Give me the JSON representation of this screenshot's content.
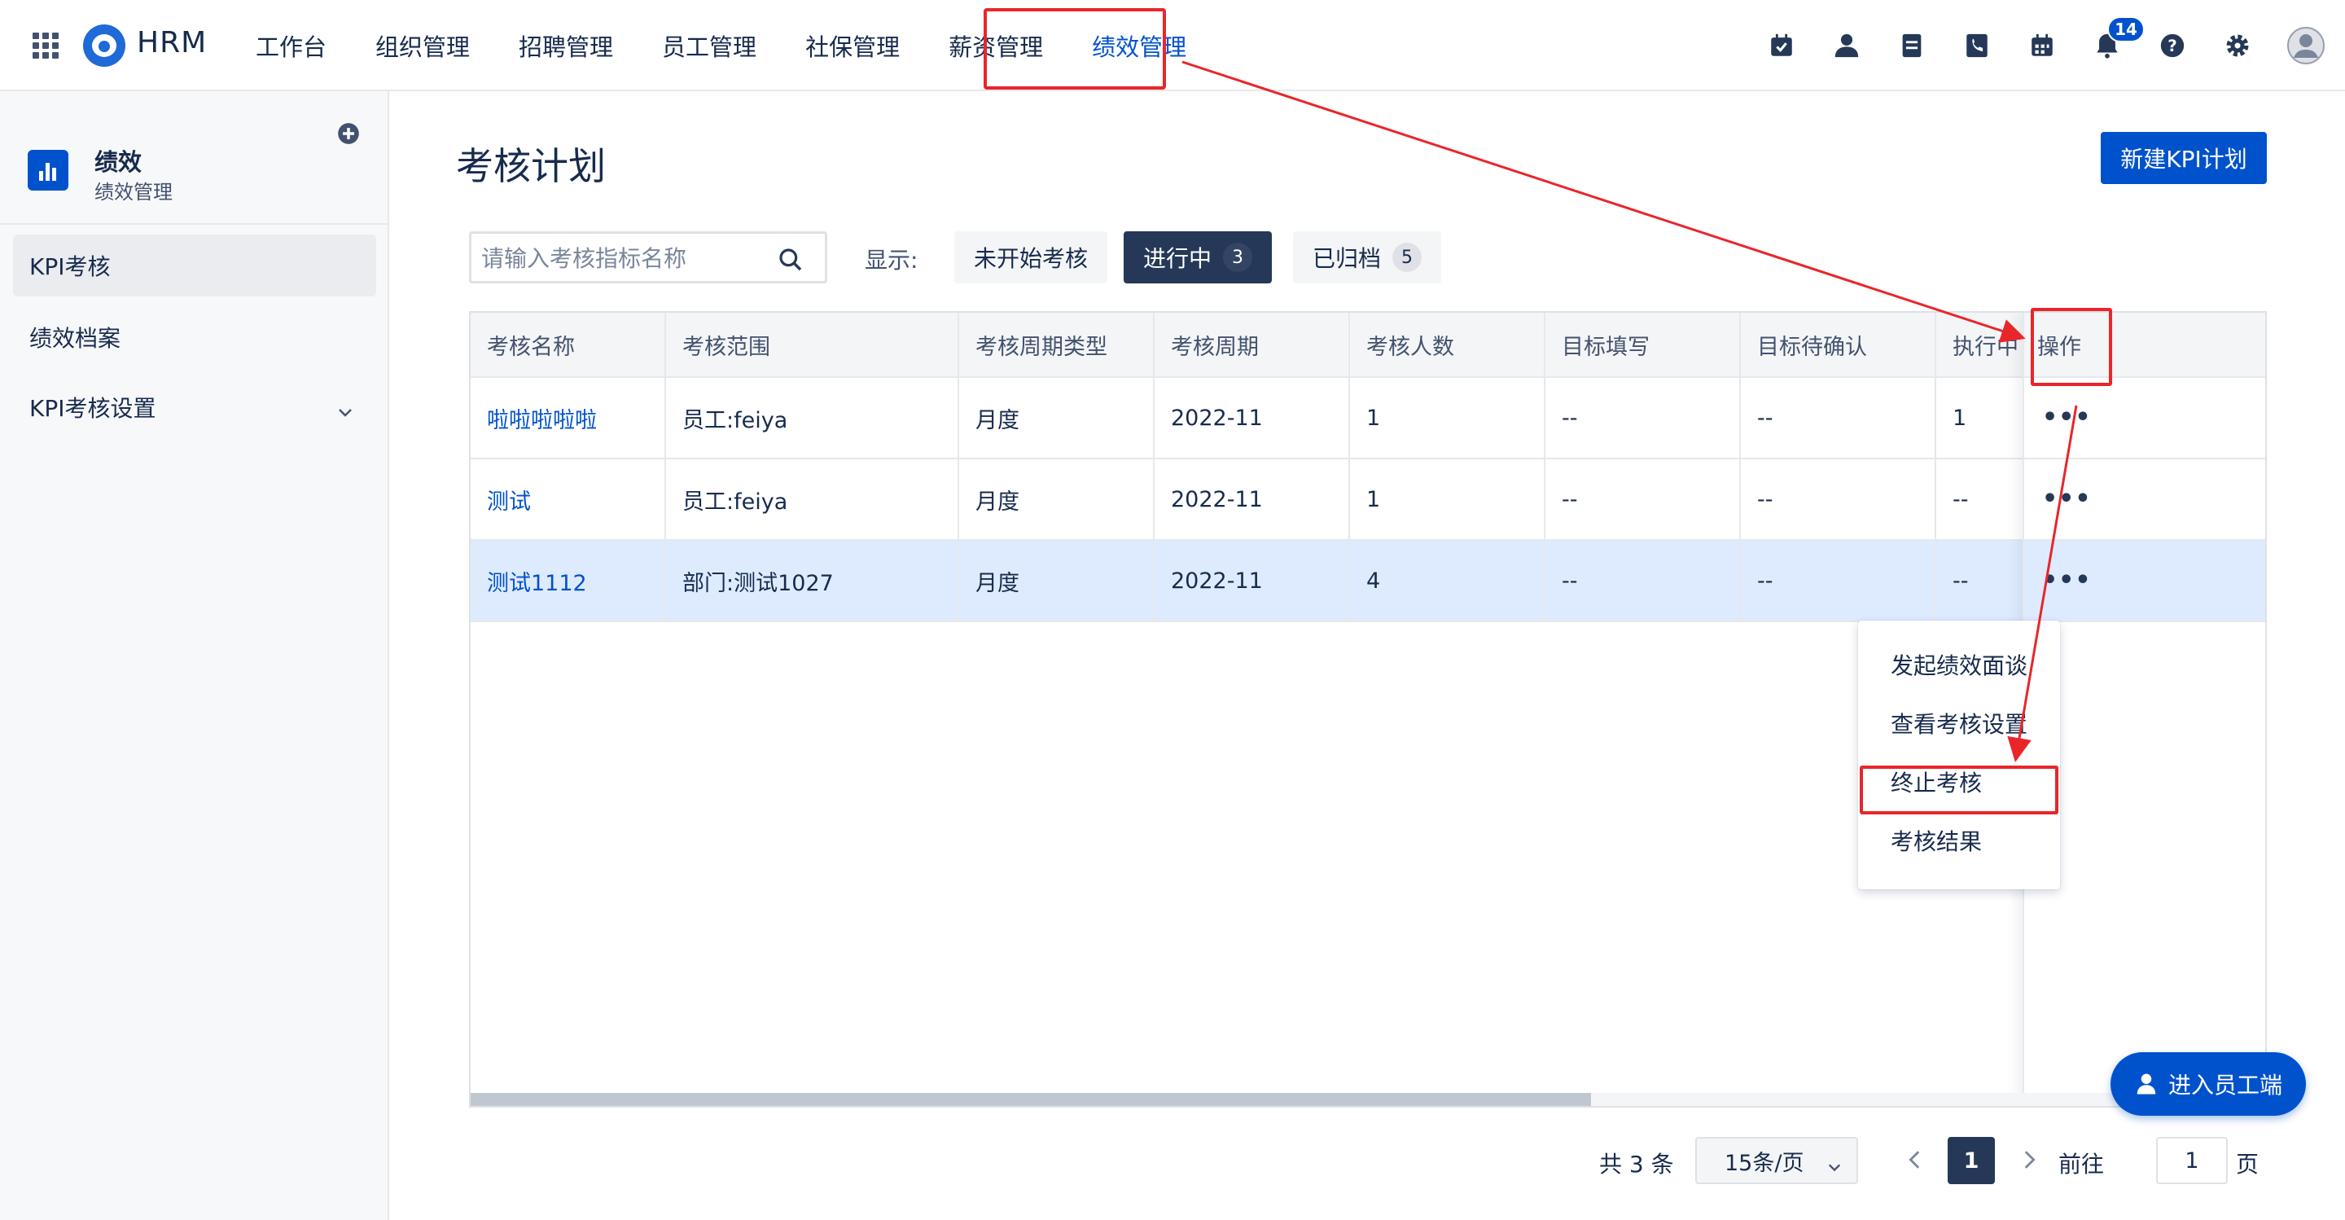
{
  "topbar": {
    "brand": "HRM",
    "nav": [
      "工作台",
      "组织管理",
      "招聘管理",
      "员工管理",
      "社保管理",
      "薪资管理",
      "绩效管理"
    ],
    "active_nav": "绩效管理",
    "notification_count": "14",
    "tool_icons": [
      "calendar-check-icon",
      "person-icon",
      "document-icon",
      "phone-icon",
      "calendar-icon",
      "bell-icon",
      "help-icon",
      "gear-icon",
      "avatar"
    ]
  },
  "sidebar": {
    "title": "绩效",
    "subtitle": "绩效管理",
    "items": [
      {
        "label": "KPI考核"
      },
      {
        "label": "绩效档案"
      },
      {
        "label": "KPI考核设置"
      }
    ]
  },
  "main": {
    "title": "考核计划",
    "new_button": "新建KPI计划",
    "search_placeholder": "请输入考核指标名称",
    "show_label": "显示:",
    "filters": [
      {
        "label": "未开始考核",
        "count": ""
      },
      {
        "label": "进行中",
        "count": "3"
      },
      {
        "label": "已归档",
        "count": "5"
      }
    ],
    "table": {
      "columns": [
        "考核名称",
        "考核范围",
        "考核周期类型",
        "考核周期",
        "考核人数",
        "目标填写",
        "目标待确认",
        "执行中"
      ],
      "op_column": "操作",
      "more_label": "•••",
      "rows": [
        [
          "啦啦啦啦啦",
          "员工:feiya",
          "月度",
          "2022-11",
          "1",
          "--",
          "--",
          "1"
        ],
        [
          "测试",
          "员工:feiya",
          "月度",
          "2022-11",
          "1",
          "--",
          "--",
          "--"
        ],
        [
          "测试1112",
          "部门:测试1027",
          "月度",
          "2022-11",
          "4",
          "--",
          "--",
          "--"
        ]
      ]
    },
    "dropdown": [
      "发起绩效面谈",
      "查看考核设置",
      "终止考核",
      "考核结果"
    ],
    "pagination": {
      "total": "共 3 条",
      "page_size": "15条/页",
      "current_page": "1",
      "goto_label": "前往",
      "goto_value": "1",
      "goto_suffix": "页"
    },
    "fab": "进入员工端"
  },
  "colors": {
    "primary": "#0052cc",
    "dark": "#253858",
    "highlight": "#e8262a",
    "selected_row": "#deebff"
  }
}
